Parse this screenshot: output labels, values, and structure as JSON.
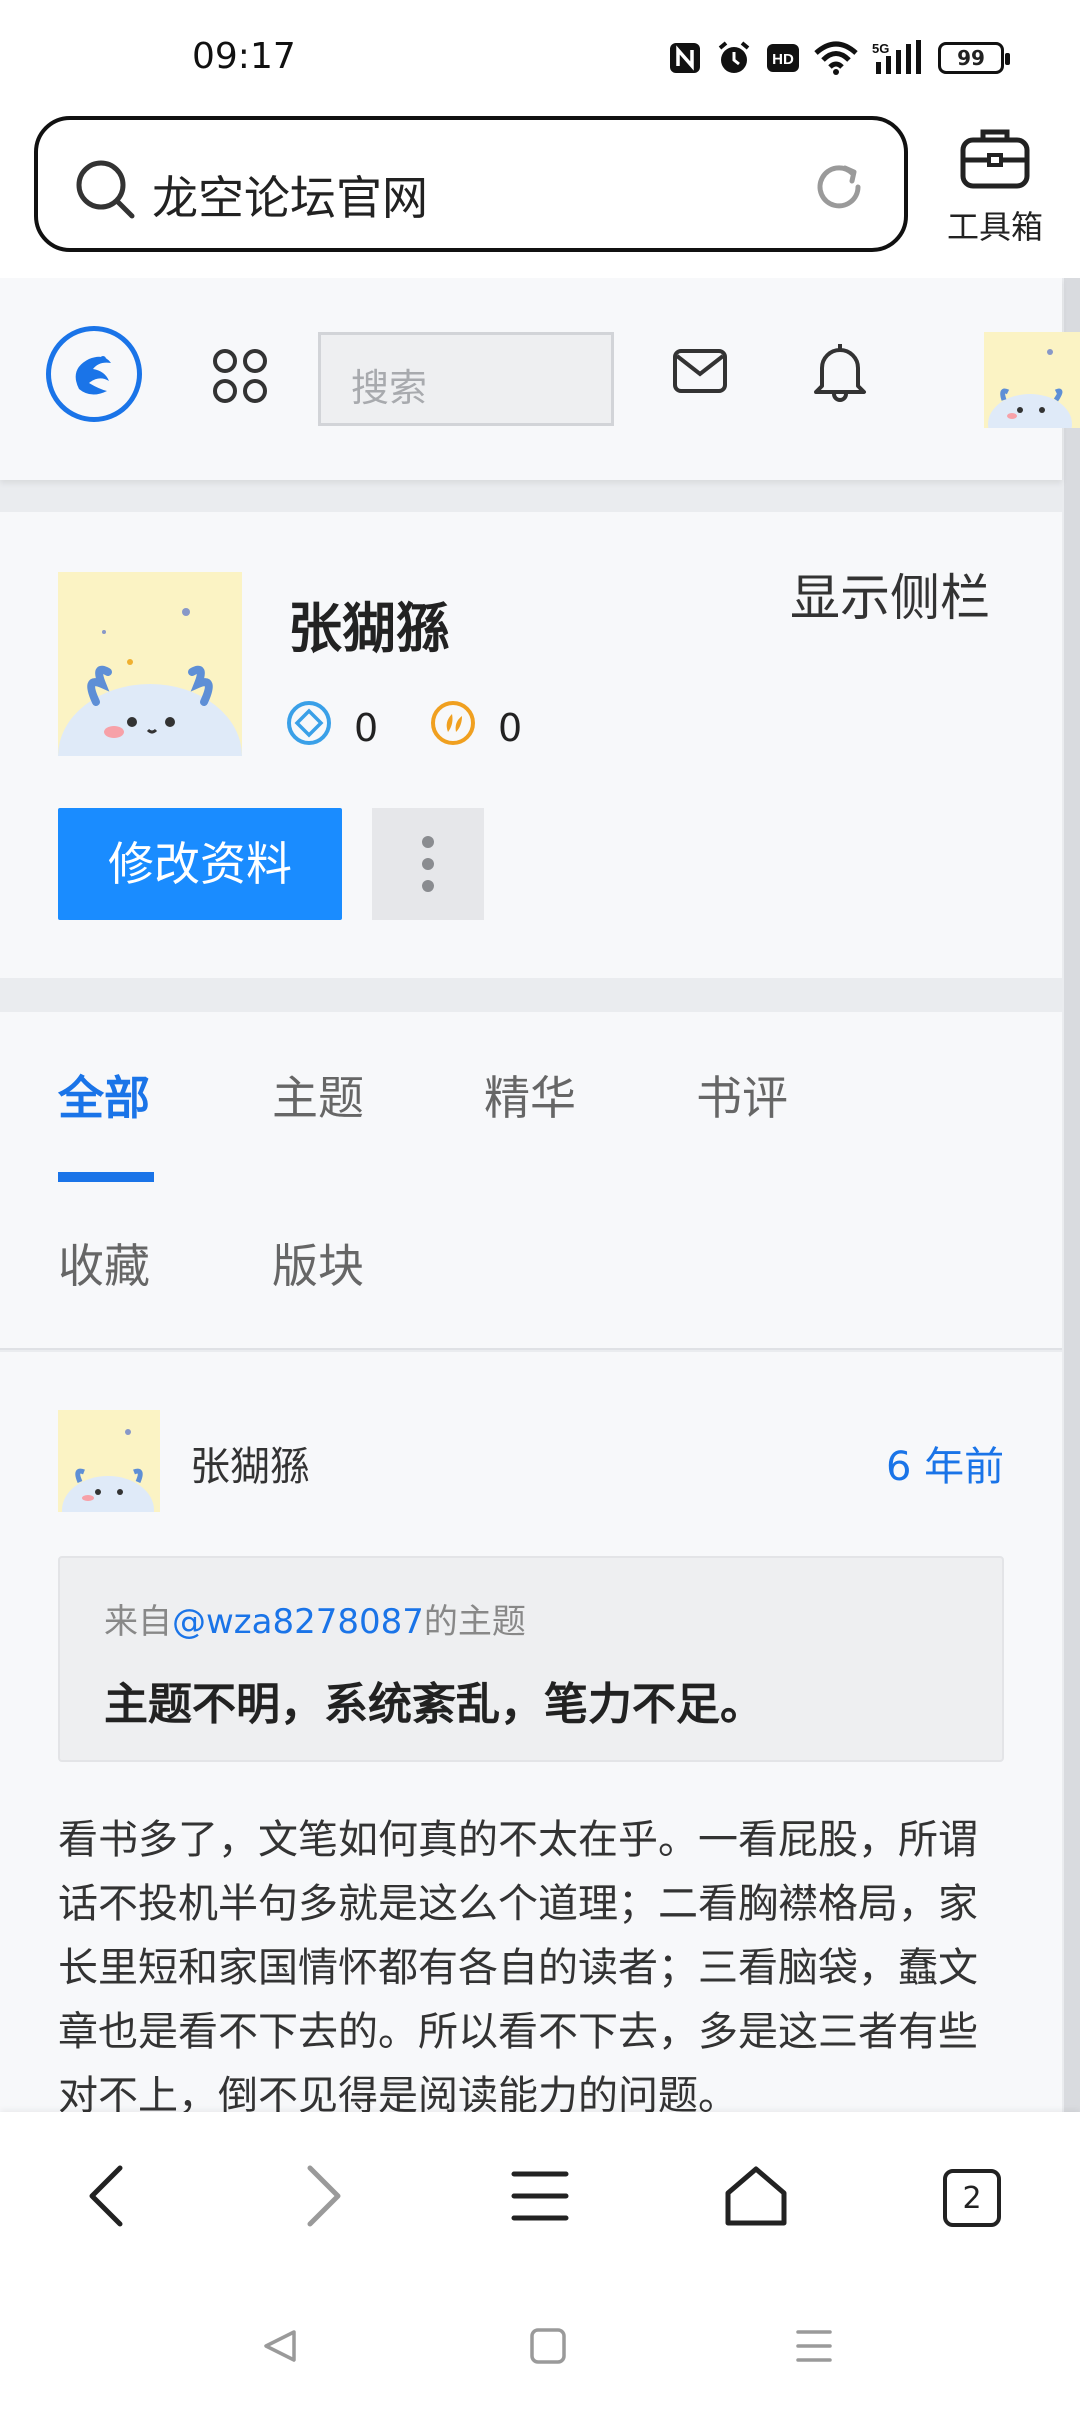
{
  "status_bar": {
    "time": "09:17",
    "battery": "99",
    "icons": [
      "nfc-icon",
      "alarm-icon",
      "hd-icon",
      "wifi-icon",
      "5g-signal-icon",
      "battery-icon"
    ]
  },
  "browser": {
    "url_text": "龙空论坛官网",
    "toolbox_label": "工具箱"
  },
  "site_header": {
    "search_placeholder": "搜索"
  },
  "profile": {
    "name": "张猢猻",
    "show_sidebar": "显示侧栏",
    "stat_diamond": "0",
    "stat_coin": "0",
    "edit_button": "修改资料"
  },
  "tabs": {
    "items": [
      "全部",
      "主题",
      "精华",
      "书评",
      "收藏",
      "版块"
    ],
    "active": "全部"
  },
  "post": {
    "author": "张猢猻",
    "time": "6 年前",
    "quote_prefix": "来自",
    "quote_user": "@wza8278087",
    "quote_suffix": "的主题",
    "quote_title": "主题不明，系统紊乱，笔力不足。",
    "body": "看书多了，文笔如何真的不太在乎。一看屁股，所谓话不投机半句多就是这么个道理；二看胸襟格局，家长里短和家国情怀都有各自的读者；三看脑袋，蠢文章也是看不下去的。所以看不下去，多是这三者有些对不上，倒不见得是阅读能力的问题。"
  },
  "bottom_nav": {
    "tab_count": "2"
  },
  "colors": {
    "accent": "#1a74e8",
    "button": "#1a8cff",
    "card_bg": "#f7f8fa",
    "page_bg": "#eaecef"
  }
}
